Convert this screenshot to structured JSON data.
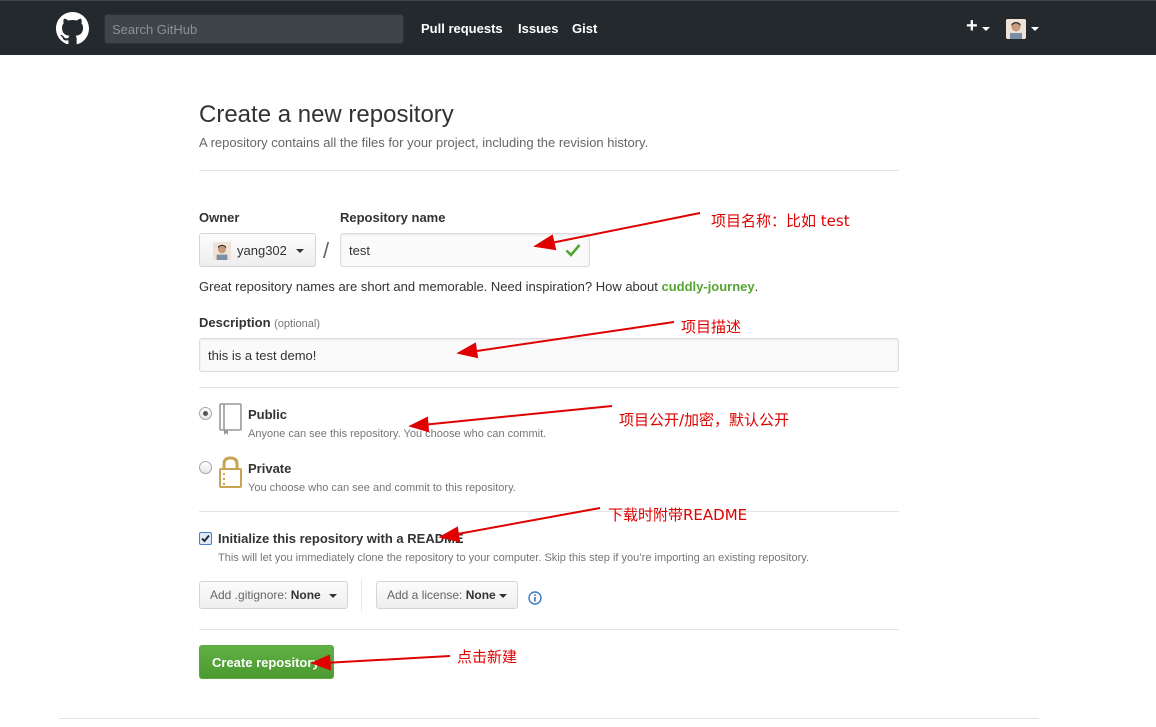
{
  "header": {
    "search_placeholder": "Search GitHub",
    "nav": [
      "Pull requests",
      "Issues",
      "Gist"
    ],
    "plus_label": "+"
  },
  "main": {
    "title": "Create a new repository",
    "subtitle": "A repository contains all the files for your project, including the revision history.",
    "owner_label": "Owner",
    "owner_name": "yang302",
    "repo_label": "Repository name",
    "repo_value": "test",
    "slash": "/",
    "hint_text": "Great repository names are short and memorable. Need inspiration? How about ",
    "hint_suggestion": "cuddly-journey",
    "hint_end": ".",
    "description_label": "Description",
    "description_optional": "(optional)",
    "description_value": "this is a test demo!",
    "public_title": "Public",
    "public_desc": "Anyone can see this repository. You choose who can commit.",
    "private_title": "Private",
    "private_desc": "You choose who can see and commit to this repository.",
    "readme_title": "Initialize this repository with a README",
    "readme_desc": "This will let you immediately clone the repository to your computer. Skip this step if you’re importing an existing repository.",
    "gitignore_prefix": "Add .gitignore: ",
    "gitignore_value": "None",
    "license_prefix": "Add a license: ",
    "license_value": "None",
    "create_button": "Create repository"
  },
  "annotations": {
    "repo_name": "项目名称：比如 test",
    "description": "项目描述",
    "visibility": "项目公开/加密，默认公开",
    "readme": "下载时附带README",
    "create": "点击新建"
  },
  "colors": {
    "header_bg": "#24292e",
    "green": "#55a532",
    "annotation_red": "#e00000"
  }
}
